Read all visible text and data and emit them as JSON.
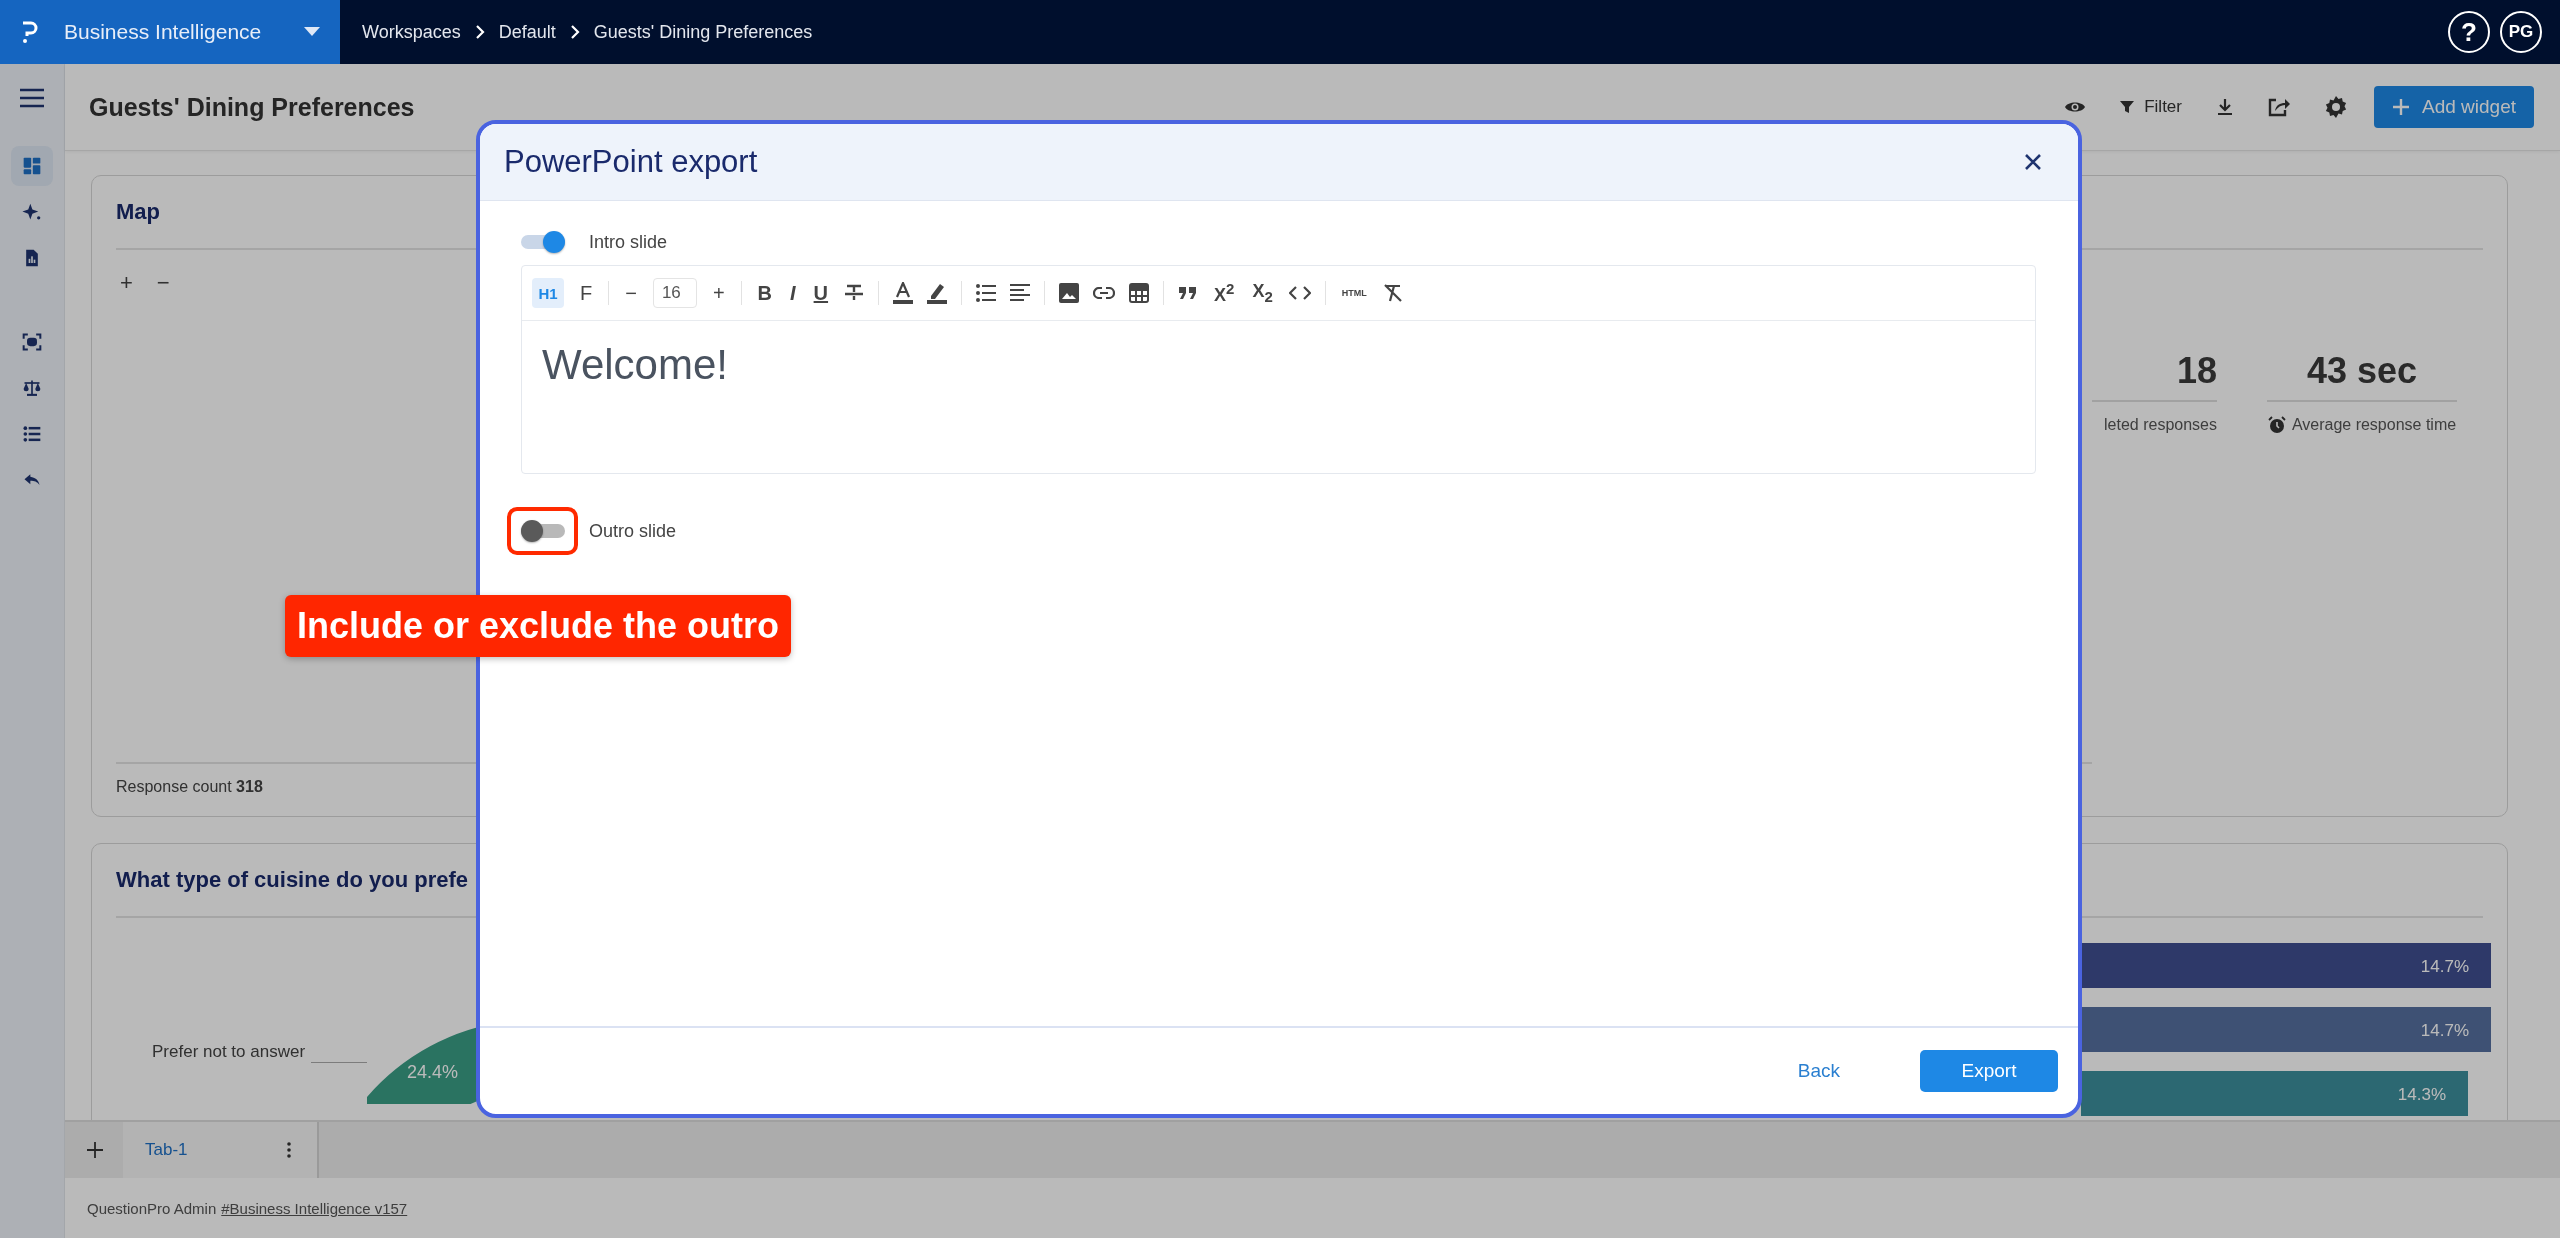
{
  "topbar": {
    "app_name": "Business Intelligence",
    "breadcrumbs": [
      "Workspaces",
      "Default",
      "Guests' Dining Preferences"
    ],
    "help": "?",
    "avatar": "PG"
  },
  "sidebar": {
    "items": [
      {
        "selected": true
      },
      {
        "selected": false
      },
      {
        "selected": false
      },
      {
        "selected": false
      },
      {
        "selected": false
      },
      {
        "selected": false
      },
      {
        "selected": false
      }
    ]
  },
  "header": {
    "title": "Guests' Dining Preferences",
    "filter": "Filter",
    "add_widget": "Add widget"
  },
  "map_card": {
    "title": "Map",
    "zoom_in": "+",
    "zoom_out": "−",
    "footer": "Response count **318**",
    "stats": [
      {
        "value": "18",
        "label": "leted responses"
      },
      {
        "value": "43 sec",
        "label": "Average response time"
      }
    ]
  },
  "cuisine_card": {
    "title": "What type of cuisine do you prefe",
    "donut_label": "Prefer not to answer",
    "donut_value": "24.4%",
    "bar_labels": [
      "14.7%",
      "14.7%",
      "14.3%"
    ]
  },
  "tabs": [
    {
      "label": "Tab-1",
      "selected": true
    }
  ],
  "footer": {
    "text": "QuestionPro Admin",
    "link": "#Business Intelligence v157"
  },
  "modal": {
    "title": "PowerPoint export",
    "intro": {
      "label": "Intro slide",
      "on": true
    },
    "toolbar": {
      "heading": "H1",
      "heading_selected": true,
      "font": "F",
      "minus": "−",
      "font_size": "16",
      "plus": "+",
      "bold": "B",
      "italic": "I",
      "underline": "U",
      "superscript": "X$^{2}$",
      "subscript": "X$_{2}$",
      "html": "HTML"
    },
    "editor_text": "Welcome!",
    "outro": {
      "label": "Outro slide",
      "on": false
    },
    "back": "Back",
    "export": "Export"
  },
  "annotation": {
    "text": "Include or exclude the outro"
  }
}
